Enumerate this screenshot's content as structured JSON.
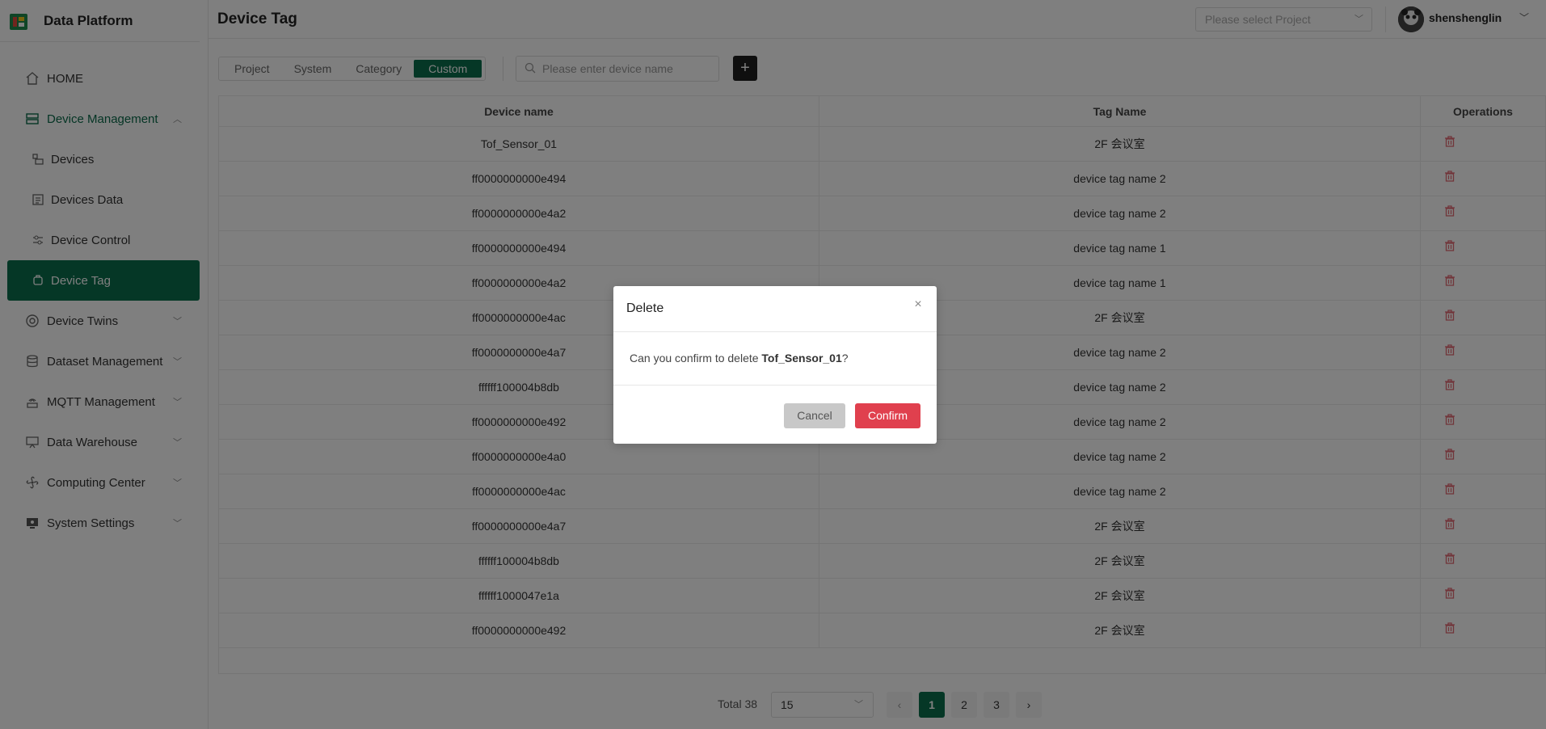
{
  "brand": {
    "title": "Data Platform"
  },
  "sidebar": {
    "items": [
      {
        "label": "HOME"
      },
      {
        "label": "Device Management"
      },
      {
        "label": "Devices"
      },
      {
        "label": "Devices Data"
      },
      {
        "label": "Device Control"
      },
      {
        "label": "Device Tag"
      },
      {
        "label": "Device Twins"
      },
      {
        "label": "Dataset Management"
      },
      {
        "label": "MQTT Management"
      },
      {
        "label": "Data Warehouse"
      },
      {
        "label": "Computing Center"
      },
      {
        "label": "System Settings"
      }
    ]
  },
  "header": {
    "title": "Device Tag",
    "project_placeholder": "Please select Project",
    "username": "shenshenglin"
  },
  "toolbar": {
    "tabs": [
      "Project",
      "System",
      "Category",
      "Custom"
    ],
    "active_tab": "Custom",
    "search_placeholder": "Please enter device name",
    "add_label": "+"
  },
  "table": {
    "headers": [
      "Device name",
      "Tag Name",
      "Operations"
    ],
    "rows": [
      [
        "Tof_Sensor_01",
        "2F 会议室"
      ],
      [
        "ff0000000000e494",
        "device tag name 2"
      ],
      [
        "ff0000000000e4a2",
        "device tag name 2"
      ],
      [
        "ff0000000000e494",
        "device tag name 1"
      ],
      [
        "ff0000000000e4a2",
        "device tag name 1"
      ],
      [
        "ff0000000000e4ac",
        "2F 会议室"
      ],
      [
        "ff0000000000e4a7",
        "device tag name 2"
      ],
      [
        "ffffff100004b8db",
        "device tag name 2"
      ],
      [
        "ff0000000000e492",
        "device tag name 2"
      ],
      [
        "ff0000000000e4a0",
        "device tag name 2"
      ],
      [
        "ff0000000000e4ac",
        "device tag name 2"
      ],
      [
        "ff0000000000e4a7",
        "2F 会议室"
      ],
      [
        "ffffff100004b8db",
        "2F 会议室"
      ],
      [
        "ffffff1000047e1a",
        "2F 会议室"
      ],
      [
        "ff0000000000e492",
        "2F 会议室"
      ]
    ]
  },
  "pagination": {
    "total": "Total 38",
    "page_size": "15",
    "pages": [
      "1",
      "2",
      "3"
    ],
    "current": "1",
    "prev": "‹",
    "next": "›"
  },
  "dialog": {
    "title": "Delete",
    "message_prefix": "Can you confirm to delete ",
    "target": "Tof_Sensor_01",
    "message_suffix": "?",
    "cancel": "Cancel",
    "confirm": "Confirm",
    "close": "×"
  },
  "colors": {
    "accent": "#0b6e4d",
    "danger": "#e0404e",
    "trash": "#e36a74"
  }
}
